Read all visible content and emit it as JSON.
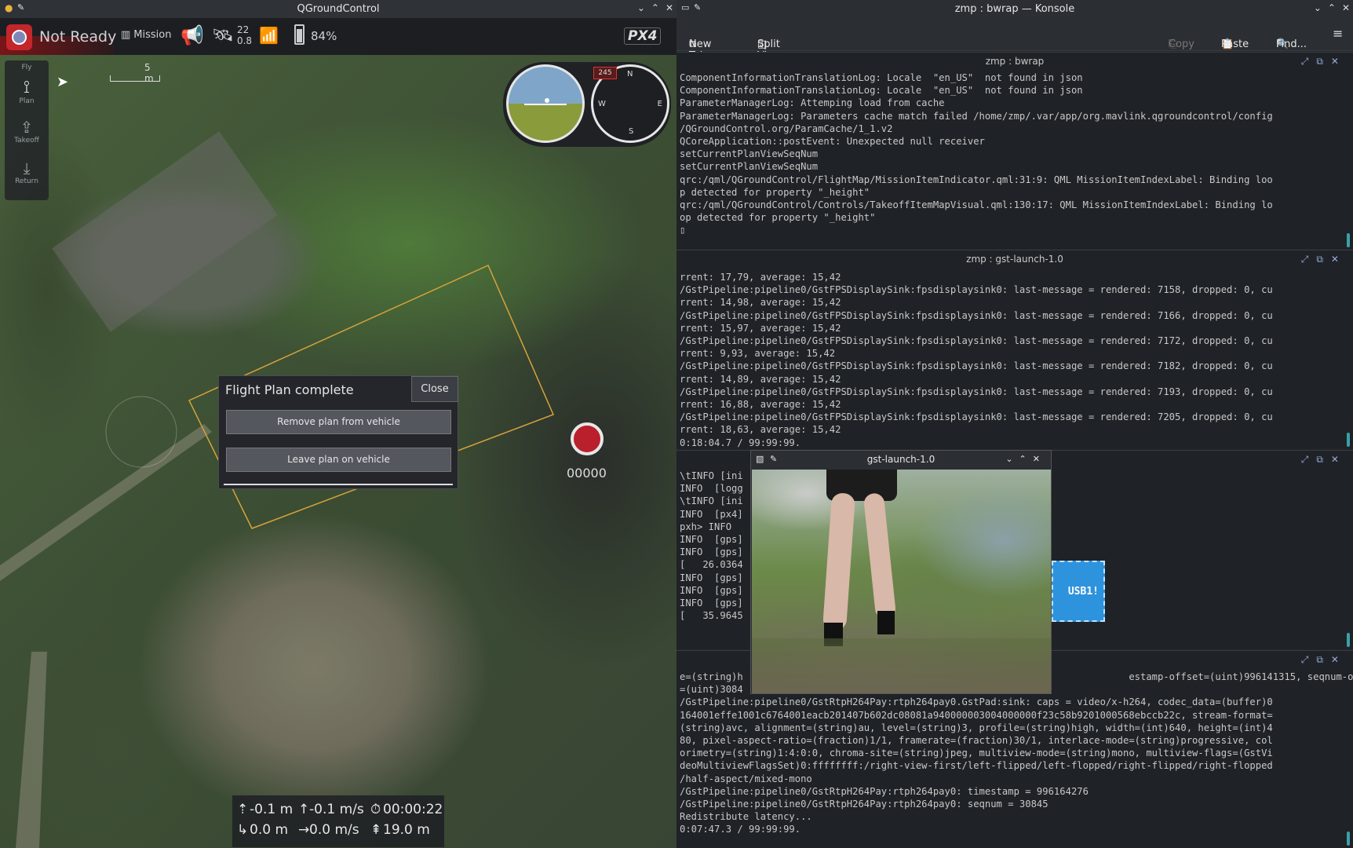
{
  "qgc": {
    "window_title": "QGroundControl",
    "status": "Not Ready",
    "mission_label": "Mission",
    "gps_sats": "22",
    "gps_hdop": "0.8",
    "battery": "84%",
    "logo_text": "PX4",
    "tools": [
      {
        "label": "Fly"
      },
      {
        "label": "Plan"
      },
      {
        "label": "Takeoff"
      },
      {
        "label": "Return"
      }
    ],
    "scale_label": "5 m",
    "compass": {
      "n": "N",
      "e": "E",
      "s": "S",
      "w": "W",
      "heading": "245"
    },
    "record_counter": "00000",
    "dialog": {
      "title": "Flight Plan complete",
      "close": "Close",
      "remove": "Remove plan from vehicle",
      "leave": "Leave plan on vehicle"
    },
    "telemetry": {
      "alt_rel": "-0.1 m",
      "vspeed": "-0.1 m/s",
      "flight_time": "00:00:22",
      "dist": "0.0 m",
      "hspeed": "0.0 m/s",
      "alt_amsl": "19.0 m"
    }
  },
  "konsole": {
    "window_title": "zmp : bwrap — Konsole",
    "toolbar": {
      "new_tab": "New Tab",
      "split_view": "Split View",
      "copy": "Copy",
      "paste": "Paste",
      "find": "Find..."
    },
    "pane1": {
      "title": "zmp : bwrap",
      "text": "ComponentInformationTranslationLog: Locale  \"en_US\"  not found in json\nComponentInformationTranslationLog: Locale  \"en_US\"  not found in json\nParameterManagerLog: Attemping load from cache\nParameterManagerLog: Parameters cache match failed /home/zmp/.var/app/org.mavlink.qgroundcontrol/config\n/QGroundControl.org/ParamCache/1_1.v2\nQCoreApplication::postEvent: Unexpected null receiver\nsetCurrentPlanViewSeqNum\nsetCurrentPlanViewSeqNum\nqrc:/qml/QGroundControl/FlightMap/MissionItemIndicator.qml:31:9: QML MissionItemIndexLabel: Binding loo\np detected for property \"_height\"\nqrc:/qml/QGroundControl/Controls/TakeoffItemMapVisual.qml:130:17: QML MissionItemIndexLabel: Binding lo\nop detected for property \"_height\"\n▯"
    },
    "pane2": {
      "title": "zmp : gst-launch-1.0",
      "text": "rrent: 17,79, average: 15,42\n/GstPipeline:pipeline0/GstFPSDisplaySink:fpsdisplaysink0: last-message = rendered: 7158, dropped: 0, cu\nrrent: 14,98, average: 15,42\n/GstPipeline:pipeline0/GstFPSDisplaySink:fpsdisplaysink0: last-message = rendered: 7166, dropped: 0, cu\nrrent: 15,97, average: 15,42\n/GstPipeline:pipeline0/GstFPSDisplaySink:fpsdisplaysink0: last-message = rendered: 7172, dropped: 0, cu\nrrent: 9,93, average: 15,42\n/GstPipeline:pipeline0/GstFPSDisplaySink:fpsdisplaysink0: last-message = rendered: 7182, dropped: 0, cu\nrrent: 14,89, average: 15,42\n/GstPipeline:pipeline0/GstFPSDisplaySink:fpsdisplaysink0: last-message = rendered: 7193, dropped: 0, cu\nrrent: 16,88, average: 15,42\n/GstPipeline:pipeline0/GstFPSDisplaySink:fpsdisplaysink0: last-message = rendered: 7205, dropped: 0, cu\nrrent: 18,63, average: 15,42\n0:18:04.7 / 99:99:99."
    },
    "pane3": {
      "text": "\\tINFO [ini\nINFO  [logg\n\\tINFO [ini\nINFO  [px4]\npxh> INFO\nINFO  [gps]\nINFO  [gps]\n[   26.0364\nINFO  [gps]\nINFO  [gps]\nINFO  [gps]\n[   35.9645"
    },
    "pane4": {
      "text": "e=(string)h                                                                   estamp-offset=(uint)996141315, seqnum-offset\n=(uint)3084\n/GstPipeline:pipeline0/GstRtpH264Pay:rtph264pay0.GstPad:sink: caps = video/x-h264, codec_data=(buffer)0\n164001effe1001c6764001eacb201407b602dc08081a940000003004000000f23c58b9201000568ebccb22c, stream-format=\n(string)avc, alignment=(string)au, level=(string)3, profile=(string)high, width=(int)640, height=(int)4\n80, pixel-aspect-ratio=(fraction)1/1, framerate=(fraction)30/1, interlace-mode=(string)progressive, col\norimetry=(string)1:4:0:0, chroma-site=(string)jpeg, multiview-mode=(string)mono, multiview-flags=(GstVi\ndeoMultiviewFlagsSet)0:ffffffff:/right-view-first/left-flipped/left-flopped/right-flipped/right-flopped\n/half-aspect/mixed-mono\n/GstPipeline:pipeline0/GstRtpH264Pay:rtph264pay0: timestamp = 996164276\n/GstPipeline:pipeline0/GstRtpH264Pay:rtph264pay0: seqnum = 30845\nRedistribute latency...\n0:07:47.3 / 99:99:99."
    }
  },
  "gst_window": {
    "title": "gst-launch-1.0"
  },
  "usb_label": "USB1!"
}
